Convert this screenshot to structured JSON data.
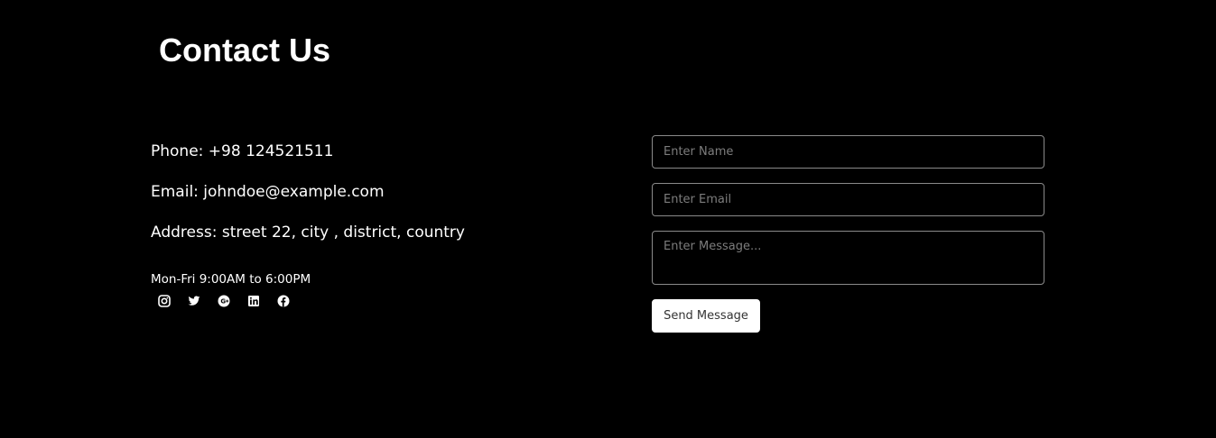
{
  "header": {
    "title": "Contact Us"
  },
  "contact_info": {
    "phone": "Phone: +98 124521511",
    "email": "Email: johndoe@example.com",
    "address": "Address: street 22, city , district, country",
    "hours": "Mon-Fri 9:00AM to 6:00PM"
  },
  "socials": [
    {
      "icon": "instagram-icon"
    },
    {
      "icon": "twitter-icon"
    },
    {
      "icon": "google-plus-icon"
    },
    {
      "icon": "linkedin-icon"
    },
    {
      "icon": "facebook-icon"
    }
  ],
  "form": {
    "name_placeholder": "Enter Name",
    "email_placeholder": "Enter Email",
    "message_placeholder": "Enter Message...",
    "send_label": "Send Message"
  },
  "colors": {
    "background": "#000000",
    "text": "#ffffff",
    "border": "#8a8a8a",
    "button_bg": "#ffffff",
    "button_text": "#333333"
  }
}
